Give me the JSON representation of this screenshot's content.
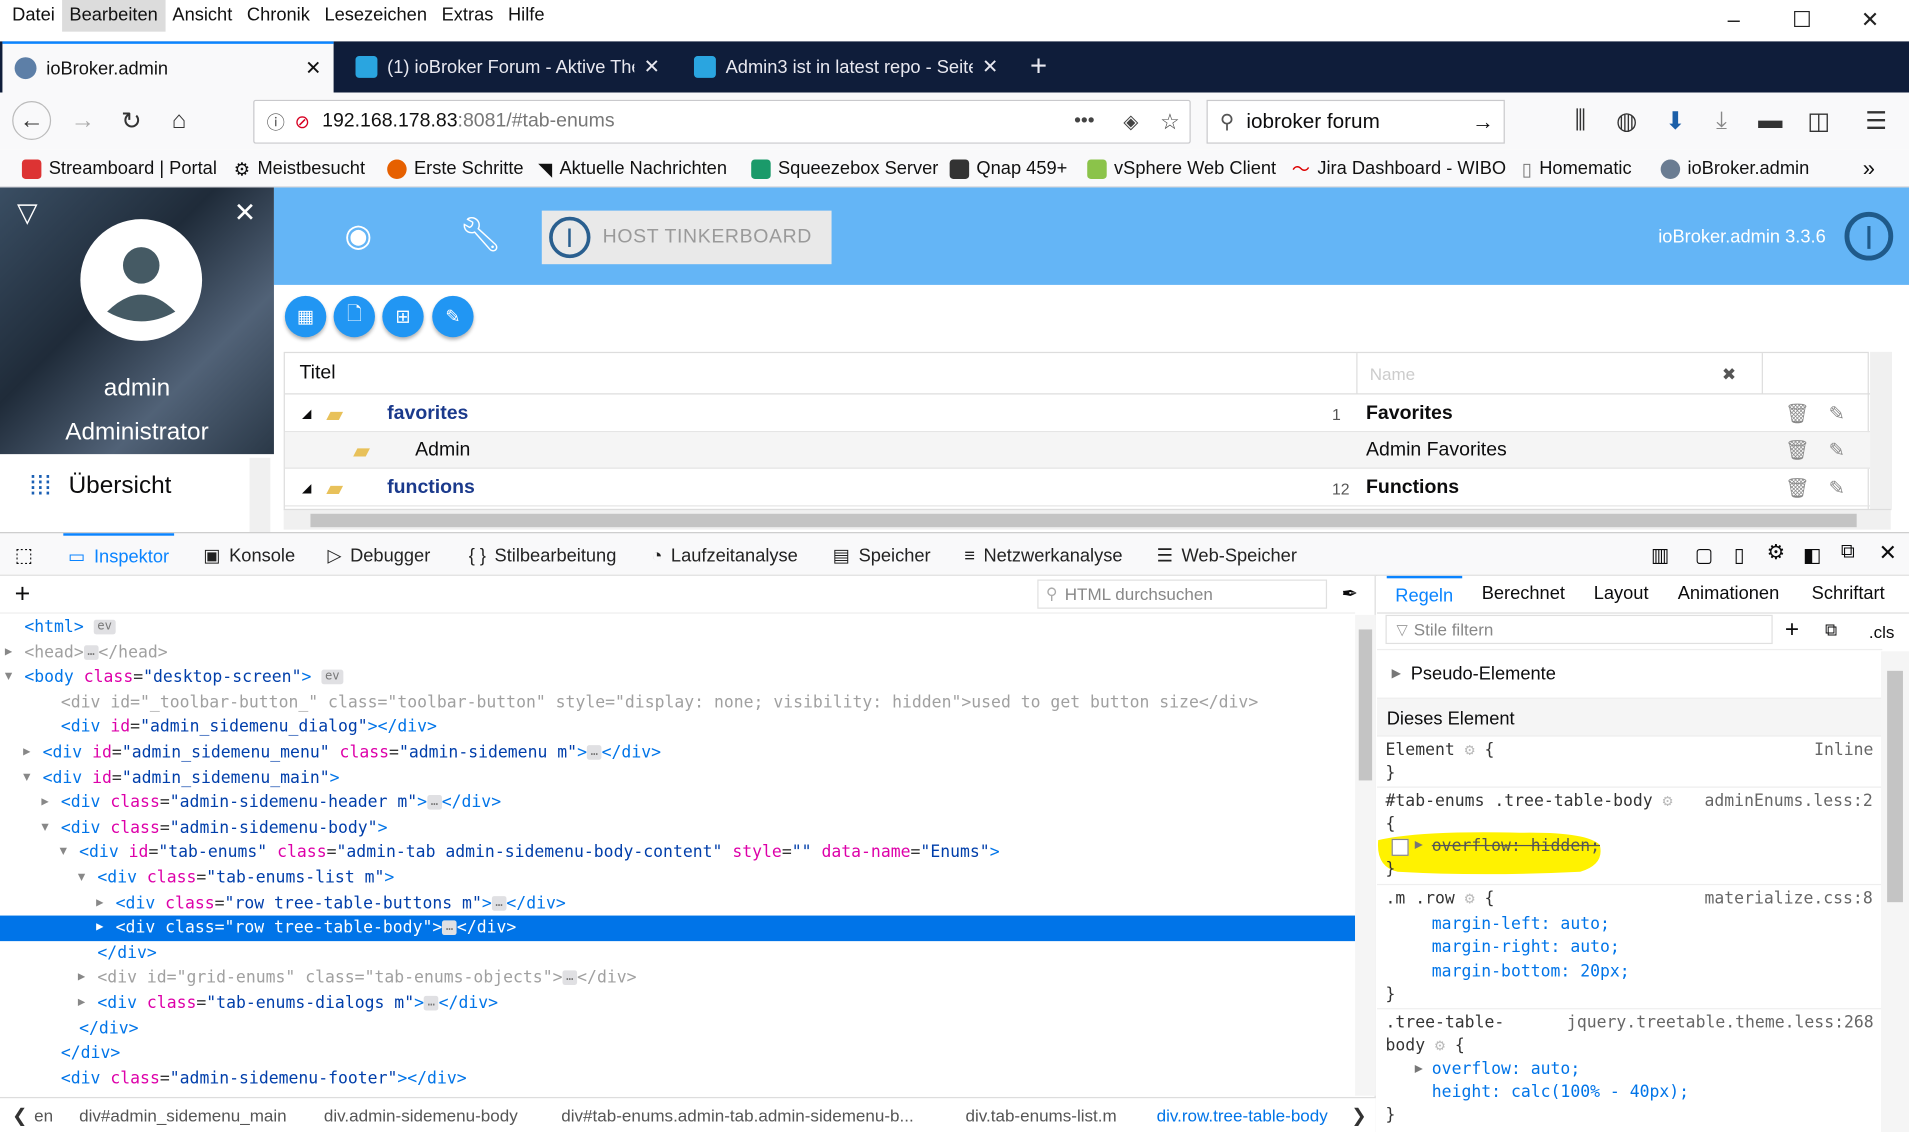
{
  "menubar": {
    "items": [
      "Datei",
      "Bearbeiten",
      "Ansicht",
      "Chronik",
      "Lesezeichen",
      "Extras",
      "Hilfe"
    ]
  },
  "tabs": [
    {
      "title": "ioBroker.admin"
    },
    {
      "title": "(1) ioBroker Forum - Aktive The"
    },
    {
      "title": "Admin3 ist in latest repo - Seite"
    }
  ],
  "url": {
    "host": "192.168.178.83",
    "rest": ":8081/#tab-enums"
  },
  "search": {
    "value": "iobroker forum"
  },
  "bookmarks": [
    "Streamboard | Portal",
    "Meistbesucht",
    "Erste Schritte",
    "Aktuelle Nachrichten",
    "Squeezebox Server",
    "Qnap 459+",
    "vSphere Web Client",
    "Jira Dashboard - WIBO",
    "Homematic",
    "ioBroker.admin"
  ],
  "sidebar": {
    "user": "admin",
    "role": "Administrator",
    "nav_item": "Übersicht"
  },
  "header": {
    "host_button": "HOST TINKERBOARD",
    "version": "ioBroker.admin 3.3.6"
  },
  "table": {
    "col_title": "Titel",
    "name_placeholder": "Name",
    "rows": [
      {
        "id": "favorites",
        "count": "1",
        "name": "Favorites"
      },
      {
        "id": "Admin",
        "count": "",
        "name": "Admin Favorites"
      },
      {
        "id": "functions",
        "count": "12",
        "name": "Functions"
      }
    ]
  },
  "devtools": {
    "tabs": [
      "Inspektor",
      "Konsole",
      "Debugger",
      "Stilbearbeitung",
      "Laufzeitanalyse",
      "Speicher",
      "Netzwerkanalyse",
      "Web-Speicher"
    ],
    "html_search_placeholder": "HTML durchsuchen",
    "sidebar_tabs": [
      "Regeln",
      "Berechnet",
      "Layout",
      "Animationen",
      "Schriftart"
    ],
    "filter_placeholder": "Stile filtern",
    "cls_label": ".cls",
    "pseudo": "Pseudo-Elemente",
    "this_element": "Dieses Element",
    "breadcrumbs": [
      "en",
      "div#admin_sidemenu_main",
      "div.admin-sidemenu-body",
      "div#tab-enums.admin-tab.admin-sidemenu-b...",
      "div.tab-enums-list.m",
      "div.row.tree-table-body"
    ]
  },
  "markup_lines": [
    {
      "html": "<span class=\"tg\">&lt;html&gt;</span> <span class=\"badge\">ev</span>"
    },
    {
      "html": "<span class=\"gr\">&lt;head&gt;</span><span class=\"badge\">…</span><span class=\"gr\">&lt;/head&gt;</span>"
    },
    {
      "html": "<span class=\"tg\">&lt;body</span> <span class=\"an\">class</span>=<span class=\"av\">\"desktop-screen\"</span><span class=\"tg\">&gt;</span> <span class=\"badge\">ev</span>"
    },
    {
      "html": "<span class=\"gr\">&lt;div id=\"_toolbar-button_\" class=\"toolbar-button\" style=\"display: none; visibility: hidden\"&gt;used to get button size&lt;/div&gt;</span>"
    },
    {
      "html": "<span class=\"tg\">&lt;div</span> <span class=\"an\">id</span>=<span class=\"av\">\"admin_sidemenu_dialog\"</span><span class=\"tg\">&gt;&lt;/div&gt;</span>"
    },
    {
      "html": "<span class=\"tg\">&lt;div</span> <span class=\"an\">id</span>=<span class=\"av\">\"admin_sidemenu_menu\"</span> <span class=\"an\">class</span>=<span class=\"av\">\"admin-sidemenu m\"</span><span class=\"tg\">&gt;</span><span class=\"badge\">…</span><span class=\"tg\">&lt;/div&gt;</span>"
    },
    {
      "html": "<span class=\"tg\">&lt;div</span> <span class=\"an\">id</span>=<span class=\"av\">\"admin_sidemenu_main\"</span><span class=\"tg\">&gt;</span>"
    },
    {
      "html": "<span class=\"tg\">&lt;div</span> <span class=\"an\">class</span>=<span class=\"av\">\"admin-sidemenu-header m\"</span><span class=\"tg\">&gt;</span><span class=\"badge\">…</span><span class=\"tg\">&lt;/div&gt;</span>"
    },
    {
      "html": "<span class=\"tg\">&lt;div</span> <span class=\"an\">class</span>=<span class=\"av\">\"admin-sidemenu-body\"</span><span class=\"tg\">&gt;</span>"
    },
    {
      "html": "<span class=\"tg\">&lt;div</span> <span class=\"an\">id</span>=<span class=\"av\">\"tab-enums\"</span> <span class=\"an\">class</span>=<span class=\"av\">\"admin-tab admin-sidemenu-body-content\"</span> <span class=\"an\">style</span>=<span class=\"av\">\"\"</span> <span class=\"an\">data-name</span>=<span class=\"av\">\"Enums\"</span><span class=\"tg\">&gt;</span>"
    },
    {
      "html": "<span class=\"tg\">&lt;div</span> <span class=\"an\">class</span>=<span class=\"av\">\"tab-enums-list m\"</span><span class=\"tg\">&gt;</span>"
    },
    {
      "html": "<span class=\"tg\">&lt;div</span> <span class=\"an\">class</span>=<span class=\"av\">\"row tree-table-buttons m\"</span><span class=\"tg\">&gt;</span><span class=\"badge\">…</span><span class=\"tg\">&lt;/div&gt;</span>"
    },
    {
      "html": "<span class=\"tg\">&lt;div</span> <span class=\"an\">class</span>=<span class=\"av\">\"row tree-table-body\"</span><span class=\"tg\">&gt;</span><span class=\"badge\">…</span><span class=\"tg\">&lt;/div&gt;</span>"
    },
    {
      "html": "<span class=\"tg\">&lt;/div&gt;</span>"
    },
    {
      "html": "<span class=\"gr\">&lt;div id=\"grid-enums\" class=\"tab-enums-objects\"&gt;</span><span class=\"badge\">…</span><span class=\"gr\">&lt;/div&gt;</span>"
    },
    {
      "html": "<span class=\"tg\">&lt;div</span> <span class=\"an\">class</span>=<span class=\"av\">\"tab-enums-dialogs m\"</span><span class=\"tg\">&gt;</span><span class=\"badge\">…</span><span class=\"tg\">&lt;/div&gt;</span>"
    },
    {
      "html": "<span class=\"tg\">&lt;/div&gt;</span>"
    },
    {
      "html": "<span class=\"tg\">&lt;/div&gt;</span>"
    },
    {
      "html": "<span class=\"tg\">&lt;div</span> <span class=\"an\">class</span>=<span class=\"av\">\"admin-sidemenu-footer\"</span><span class=\"tg\">&gt;&lt;/div&gt;</span>"
    }
  ],
  "rules": {
    "element": {
      "selector": "Element",
      "source": "Inline"
    },
    "r1": {
      "selector": "#tab-enums .tree-table-body",
      "source": "adminEnums.less:2",
      "decl": "overflow: hidden;"
    },
    "r2": {
      "selector": ".m .row",
      "source": "materialize.css:8",
      "decls": [
        "margin-left: auto;",
        "margin-right: auto;",
        "margin-bottom: 20px;"
      ]
    },
    "r3": {
      "selector1": ".tree-table-",
      "selector2": "body",
      "source": "jquery.treetable.theme.less:268",
      "decls": [
        "overflow: auto;",
        "height: calc(100% - 40px);"
      ]
    }
  }
}
